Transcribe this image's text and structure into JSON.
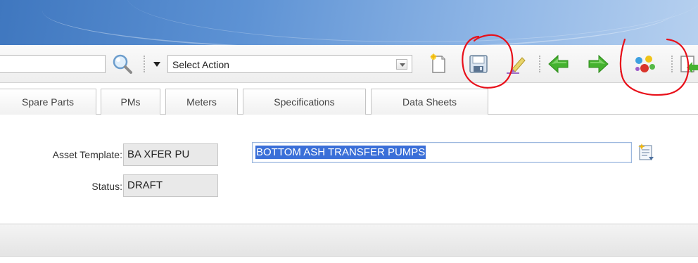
{
  "toolbar": {
    "search_value": "",
    "action_select": {
      "selected": "Select Action"
    },
    "icons": [
      "search-icon",
      "new-record-icon",
      "save-icon",
      "clear-icon",
      "previous-arrow-icon",
      "next-arrow-icon",
      "workflow-icon",
      "route-icon"
    ]
  },
  "tabs": [
    {
      "label": "Spare Parts"
    },
    {
      "label": "PMs"
    },
    {
      "label": "Meters"
    },
    {
      "label": "Specifications"
    },
    {
      "label": "Data Sheets"
    }
  ],
  "form": {
    "asset_template": {
      "label": "Asset Template:",
      "value": "BA XFER PU"
    },
    "description": {
      "value": "BOTTOM ASH TRANSFER PUMPS"
    },
    "status": {
      "label": "Status:",
      "value": "DRAFT"
    }
  },
  "colors": {
    "banner": "#5d92d4",
    "selection": "#3a6fd8",
    "annotation": "#e8101a",
    "arrow_green": "#3fae2a"
  }
}
